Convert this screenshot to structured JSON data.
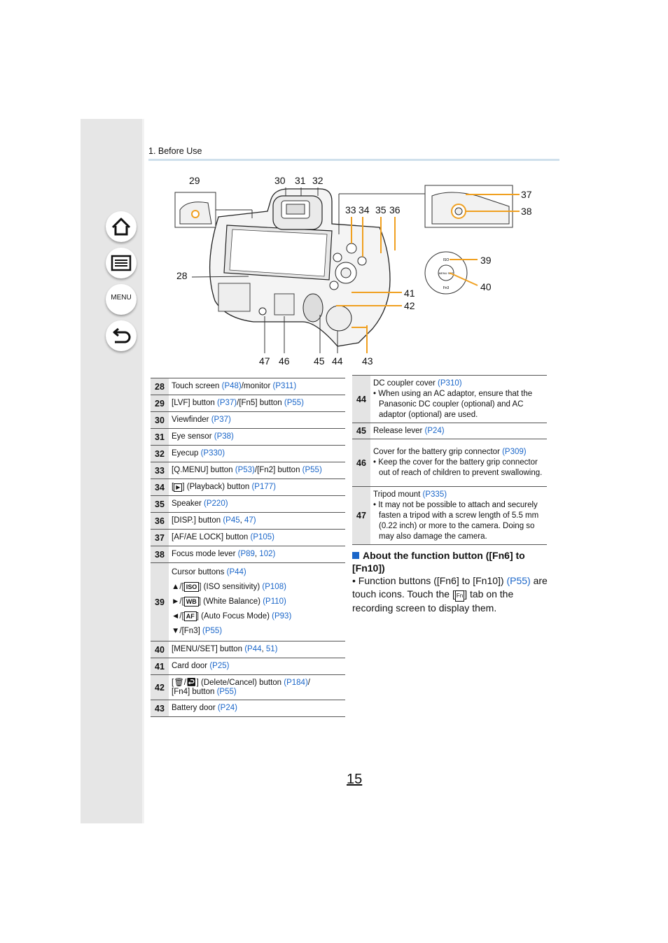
{
  "header": {
    "section": "1. Before Use"
  },
  "nav": {
    "menu_label": "MENU"
  },
  "diagram": {
    "callouts": [
      "29",
      "30",
      "31",
      "32",
      "37",
      "38",
      "33",
      "34",
      "35",
      "36",
      "28",
      "39",
      "40",
      "41",
      "42",
      "47",
      "46",
      "45",
      "44",
      "43"
    ],
    "dial_labels": {
      "iso": "ISO",
      "menu_set": "MENU SET",
      "fn3": "Fn3"
    },
    "highlight_color": "#f0a020"
  },
  "left_table": [
    {
      "num": "28",
      "text": "Touch screen ",
      "link1": "(P48)",
      "text2": "/monitor ",
      "link2": "(P311)"
    },
    {
      "num": "29",
      "text": "[LVF] button ",
      "link1": "(P37)",
      "text2": "/[Fn5] button ",
      "link2": "(P55)"
    },
    {
      "num": "30",
      "text": "Viewfinder ",
      "link1": "(P37)"
    },
    {
      "num": "31",
      "text": "Eye sensor ",
      "link1": "(P38)"
    },
    {
      "num": "32",
      "text": "Eyecup ",
      "link1": "(P330)"
    },
    {
      "num": "33",
      "text": "[Q.MENU] button ",
      "link1": "(P53)",
      "text2": "/[Fn2] button ",
      "link2": "(P55)"
    },
    {
      "num": "34",
      "text_pre": "[",
      "text": "] (Playback) button ",
      "link1": "(P177)"
    },
    {
      "num": "35",
      "text": "Speaker ",
      "link1": "(P220)"
    },
    {
      "num": "36",
      "text": "[DISP.] button ",
      "link1": "(P45",
      "text2": ", ",
      "link2": "47)"
    },
    {
      "num": "37",
      "text": "[AF/AE LOCK] button ",
      "link1": "(P105)"
    },
    {
      "num": "38",
      "text": "Focus mode lever ",
      "link1": "(P89",
      "text2": ", ",
      "link2": "102)"
    }
  ],
  "row39": {
    "num": "39",
    "title": "Cursor buttons ",
    "title_link": "(P44)",
    "lines": [
      {
        "arrow": "▲/[",
        "icon": "ISO",
        "text": "] (ISO sensitivity) ",
        "link": "(P108)"
      },
      {
        "arrow": "►/[",
        "icon": "WB",
        "text": "] (White Balance) ",
        "link": "(P110)"
      },
      {
        "arrow": "◄/[",
        "icon": "AF",
        "text": "] (Auto Focus Mode) ",
        "link": "(P93)"
      },
      {
        "arrow": "▼/[Fn3] ",
        "icon": "",
        "text": "",
        "link": "(P55)"
      }
    ]
  },
  "left_table_tail": [
    {
      "num": "40",
      "text": "[MENU/SET] button ",
      "link1": "(P44",
      "text2": ", ",
      "link2": "51)"
    },
    {
      "num": "41",
      "text": "Card door ",
      "link1": "(P25)"
    }
  ],
  "row42": {
    "num": "42",
    "text_pre": "[",
    "text": "] (Delete/Cancel) button ",
    "link1": "(P184)",
    "text2": "/",
    "line2": "[Fn4] button ",
    "link2": "(P55)"
  },
  "row43": {
    "num": "43",
    "text": "Battery door ",
    "link1": "(P24)"
  },
  "right_table": [
    {
      "num": "44",
      "title": "DC coupler cover ",
      "link": "(P310)",
      "bullet": "When using an AC adaptor, ensure that the Panasonic DC coupler (optional) and AC adaptor (optional) are used."
    },
    {
      "num": "45",
      "title": "Release lever ",
      "link": "(P24)",
      "bullet": ""
    },
    {
      "num": "46",
      "title": "Cover for the battery grip connector ",
      "link": "(P309)",
      "bullet": "Keep the cover for the battery grip connector out of reach of children to prevent swallowing."
    },
    {
      "num": "47",
      "title": "Tripod mount ",
      "link": "(P335)",
      "bullet": "It may not be possible to attach and securely fasten a tripod with a screw length of 5.5 mm (0.22 inch) or more to the camera. Doing so may also damage the camera."
    }
  ],
  "note": {
    "title": "About the function button ([Fn6] to [Fn10])",
    "body_pre": "Function buttons ([Fn6] to [Fn10]) ",
    "body_link": "(P55)",
    "body_mid": " are touch icons. Touch the [",
    "body_post": "] tab on the recording screen to display them."
  },
  "page_number": "15"
}
